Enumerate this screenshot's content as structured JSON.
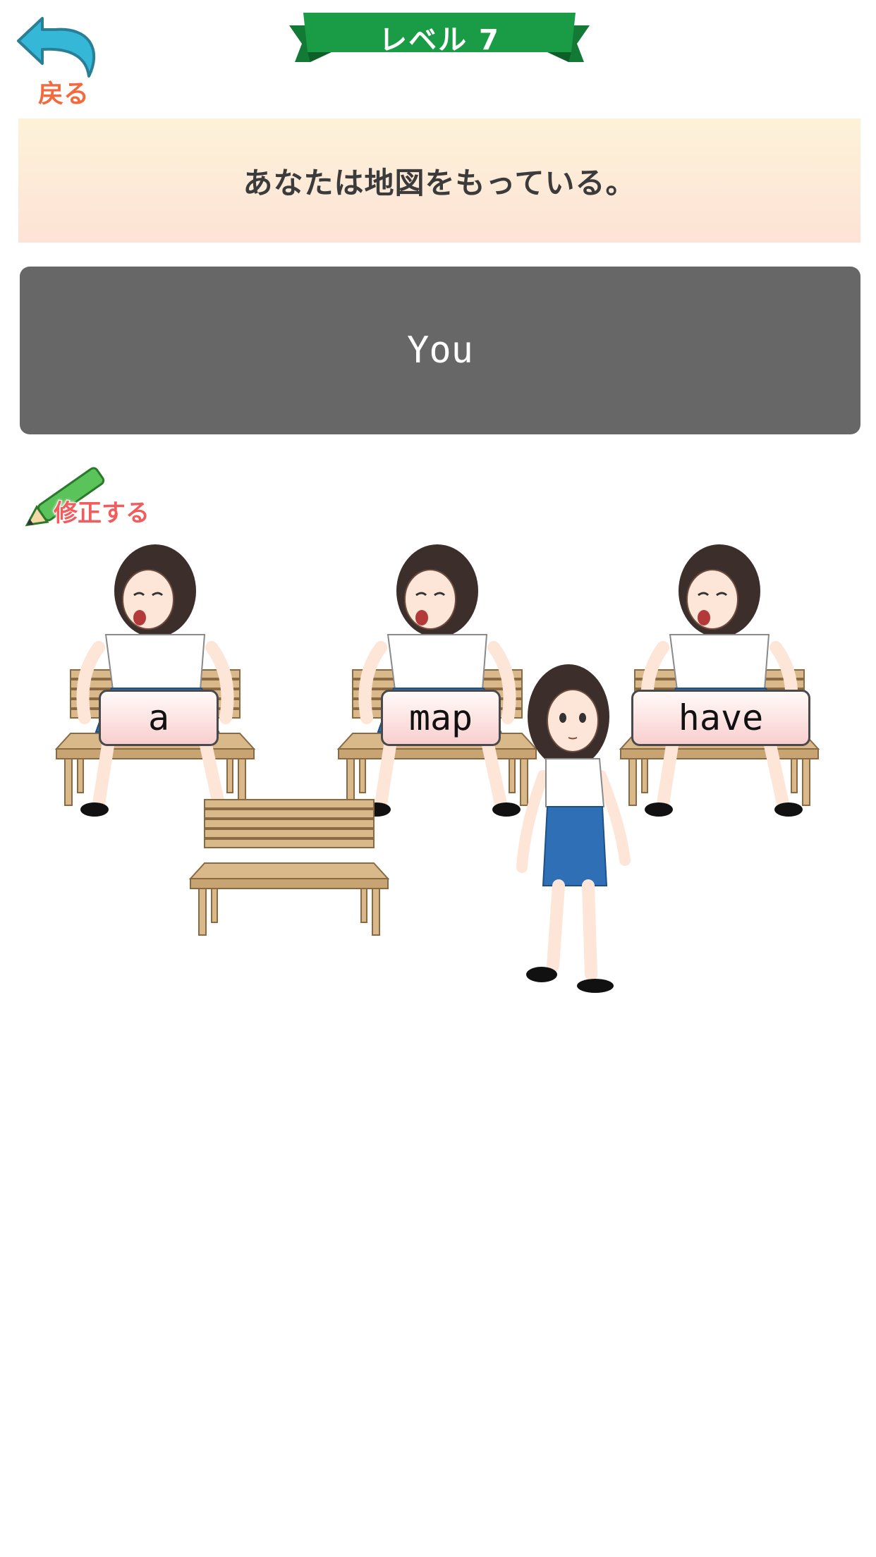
{
  "header": {
    "back_label": "戻る",
    "level_title": "レベル 7"
  },
  "question": {
    "japanese_sentence": "あなたは地図をもっている。",
    "answer_text": "You"
  },
  "edit_label": "修正する",
  "word_cards": [
    {
      "label": "a"
    },
    {
      "label": "map"
    },
    {
      "label": "have"
    }
  ],
  "colors": {
    "banner_green": "#1a9b45",
    "back_arrow": "#33b6d6",
    "answer_bg": "#676767",
    "pencil_green": "#5ac35a"
  },
  "icons": [
    "back-arrow-icon",
    "pencil-icon"
  ]
}
